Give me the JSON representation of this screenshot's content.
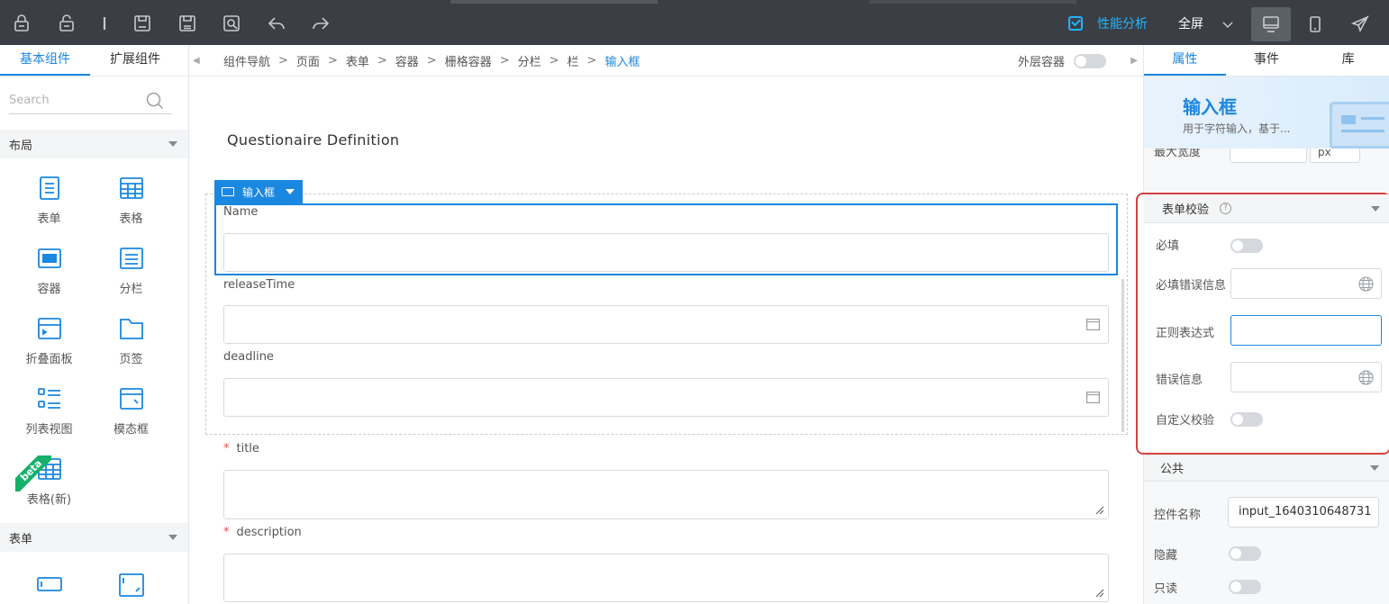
{
  "toolbar": {
    "perf_label": "性能分析",
    "fullscreen_label": "全屏"
  },
  "left": {
    "tabs": [
      "基本组件",
      "扩展组件"
    ],
    "search_placeholder": "Search",
    "section_layout": "布局",
    "components": [
      "表单",
      "表格",
      "容器",
      "分栏",
      "折叠面板",
      "页签",
      "列表视图",
      "模态框",
      "表格(新)"
    ],
    "beta_badge": "beta",
    "section_form": "表单"
  },
  "breadcrumb": [
    "组件导航",
    "页面",
    "表单",
    "容器",
    "栅格容器",
    "分栏",
    "栏",
    "输入框"
  ],
  "outer_container_label": "外层容器",
  "canvas": {
    "form_title": "Questionaire Definition",
    "selected_tag": "输入框",
    "fields": {
      "name": "Name",
      "release": "releaseTime",
      "deadline": "deadline",
      "title": "title",
      "description": "description",
      "required_mark": "*"
    }
  },
  "right": {
    "tabs": [
      "属性",
      "事件",
      "库"
    ],
    "header_title": "输入框",
    "header_desc": "用于字符输入，基于...",
    "peek_label": "最大宽度",
    "peek_unit": "px",
    "validation": {
      "title": "表单校验",
      "help": "?",
      "required": "必填",
      "required_msg": "必填错误信息",
      "regex": "正则表达式",
      "error_msg": "错误信息",
      "custom": "自定义校验"
    },
    "public": {
      "title": "公共",
      "name_label": "控件名称",
      "name_value": "input_1640310648731",
      "hidden": "隐藏",
      "readonly": "只读"
    }
  },
  "colors": {
    "accent": "#1a87e0",
    "toolbar_bg": "#3b3f45",
    "highlight_border": "#d4423f",
    "beta": "#16b06b"
  }
}
